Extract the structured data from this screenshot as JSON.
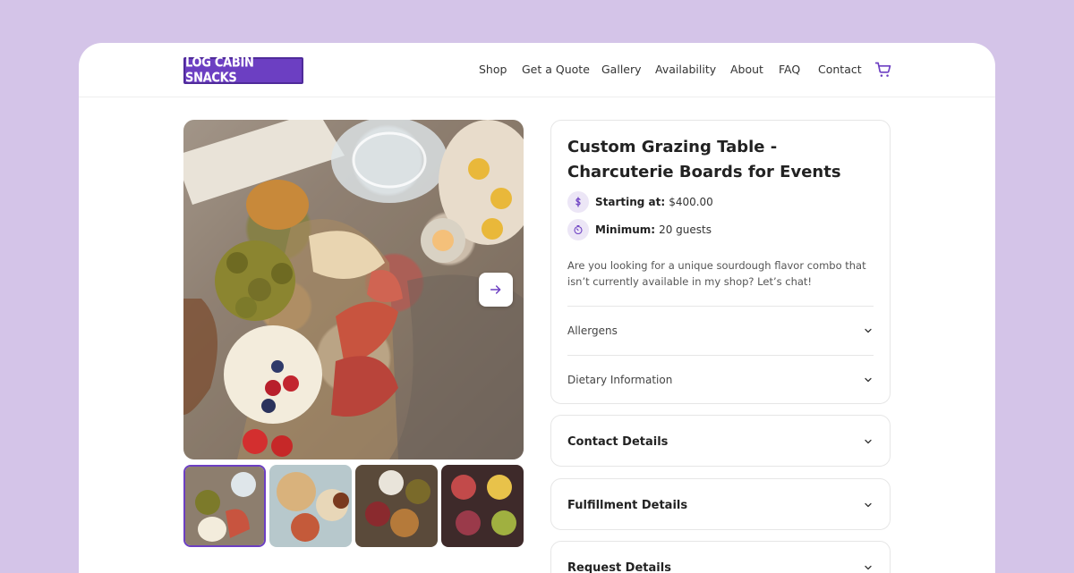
{
  "header": {
    "logo_text": "LOG CABIN SNACKS",
    "nav": [
      "Shop",
      "Get a Quote",
      "Gallery",
      "Availability",
      "About",
      "FAQ",
      "Contact"
    ],
    "cart_icon": "cart-icon"
  },
  "gallery": {
    "next_icon": "arrow-right-icon",
    "thumbnail_count": 4,
    "active_thumbnail": 1
  },
  "product": {
    "title": "Custom Grazing Table - Charcuterie Boards for Events",
    "starting_label": "Starting at:",
    "starting_value": "$400.00",
    "minimum_label": "Minimum:",
    "minimum_value": "20 guests",
    "description": "Are you looking for a unique sourdough flavor combo that isn’t currently available in my shop? Let’s chat!",
    "accordions": [
      "Allergens",
      "Dietary Information"
    ]
  },
  "sections": [
    "Contact Details",
    "Fulfillment Details",
    "Request Details"
  ],
  "colors": {
    "accent": "#6c3fc2",
    "background": "#d4c4e8",
    "accent_light": "#ece6f6"
  }
}
